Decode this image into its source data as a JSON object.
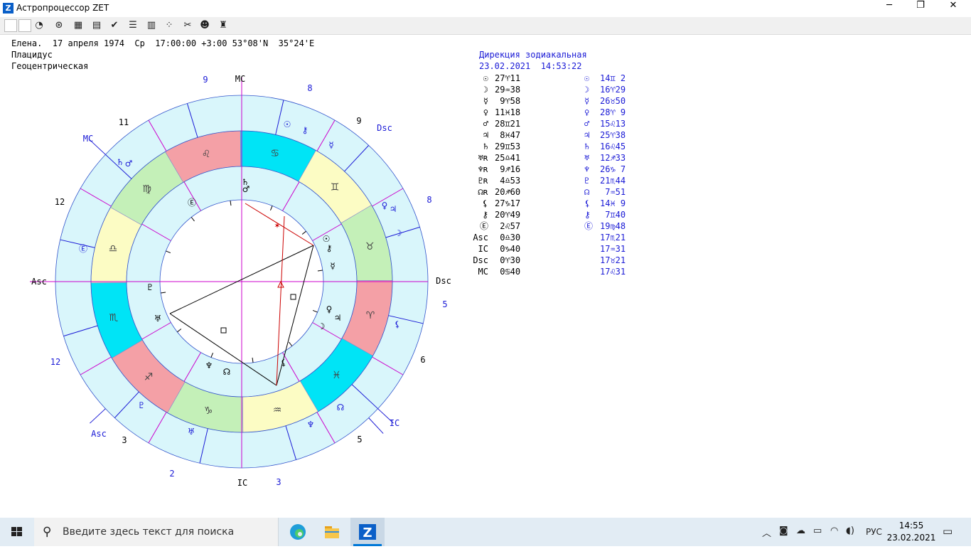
{
  "window": {
    "title": "Астропроцессор ZET",
    "icon": "Z",
    "minimize": "─",
    "restore": "❐",
    "close": "✕"
  },
  "toolbar": [
    {
      "name": "toolbar-blank-1",
      "glyph": ""
    },
    {
      "name": "toolbar-blank-2",
      "glyph": ""
    },
    {
      "name": "toolbar-chart-icon",
      "glyph": "◔"
    },
    {
      "name": "toolbar-wheel-icon",
      "glyph": "⊛"
    },
    {
      "name": "toolbar-grid-icon",
      "glyph": "▦"
    },
    {
      "name": "toolbar-document-icon",
      "glyph": "▤"
    },
    {
      "name": "toolbar-check-icon",
      "glyph": "✔"
    },
    {
      "name": "toolbar-text-icon",
      "glyph": "☰"
    },
    {
      "name": "toolbar-table-icon",
      "glyph": "▥"
    },
    {
      "name": "toolbar-dots-icon",
      "glyph": "⁘"
    },
    {
      "name": "toolbar-tools-icon",
      "glyph": "✂"
    },
    {
      "name": "toolbar-person-icon",
      "glyph": "☻"
    },
    {
      "name": "toolbar-run-icon",
      "glyph": "♜"
    }
  ],
  "header": {
    "line1": "Елена.  17 апреля 1974  Ср  17:00:00 +3:00 53°08'N  35°24'E",
    "line2": "Плацидус",
    "line3": "Геоцентрическая"
  },
  "chart_data": {
    "type": "other",
    "title": "",
    "natal_angles": [
      {
        "label": "MC",
        "color": "#000000"
      },
      {
        "label": "Asc",
        "color": "#000000"
      },
      {
        "label": "Dsc",
        "color": "#000000"
      },
      {
        "label": "IC",
        "color": "#000000"
      }
    ],
    "direction_angles": [
      {
        "label": "MC",
        "color": "#1a1ad6"
      },
      {
        "label": "Dsc",
        "color": "#1a1ad6"
      },
      {
        "label": "Asc",
        "color": "#1a1ad6"
      },
      {
        "label": "IC",
        "color": "#1a1ad6"
      }
    ],
    "natal_house_labels": [
      "9",
      "11",
      "12",
      "Asc",
      "12",
      "3",
      "2",
      "IC",
      "3",
      "5",
      "6",
      "Dsc",
      "5",
      "8",
      "9",
      "8"
    ],
    "zodiac_sectors": [
      {
        "sign": "♈",
        "color": "#f4a0a6"
      },
      {
        "sign": "♉",
        "color": "#c4f0b8"
      },
      {
        "sign": "♊",
        "color": "#fcfcc4"
      },
      {
        "sign": "♋",
        "color": "#00e4f6"
      },
      {
        "sign": "♌",
        "color": "#f4a0a6"
      },
      {
        "sign": "♍",
        "color": "#c4f0b8"
      },
      {
        "sign": "♎",
        "color": "#fcfcc4"
      },
      {
        "sign": "♏",
        "color": "#00e4f6"
      },
      {
        "sign": "♐",
        "color": "#f4a0a6"
      },
      {
        "sign": "♑",
        "color": "#c4f0b8"
      },
      {
        "sign": "♒",
        "color": "#fcfcc4"
      },
      {
        "sign": "♓",
        "color": "#00e4f6"
      }
    ],
    "ring_colors": {
      "outer": "#d9f6fb",
      "inner": "#d9f6fb",
      "lines": "#3333cc",
      "cusps": "#cc00cc"
    }
  },
  "panel": {
    "title": "Дирекция зодиакальная",
    "datetime": "23.02.2021  14:53:22",
    "rows": [
      {
        "glyph": "☉",
        "natal": "27♈11",
        "dglyph": "☉",
        "direct": "14♊ 2"
      },
      {
        "glyph": "☽",
        "natal": "29♒38",
        "dglyph": "☽",
        "direct": "16♈29"
      },
      {
        "glyph": "☿",
        "natal": " 9♈58",
        "dglyph": "☿",
        "direct": "26♉50"
      },
      {
        "glyph": "♀",
        "natal": "11♓18",
        "dglyph": "♀",
        "direct": "28♈ 9"
      },
      {
        "glyph": "♂",
        "natal": "28♊21",
        "dglyph": "♂",
        "direct": "15♌13"
      },
      {
        "glyph": "♃",
        "natal": " 8♓47",
        "dglyph": "♃",
        "direct": "25♈38"
      },
      {
        "glyph": "♄",
        "natal": "29♊53",
        "dglyph": "♄",
        "direct": "16♌45"
      },
      {
        "glyph": "♅ʀ",
        "natal": "25♎41",
        "dglyph": "♅",
        "direct": "12♐33"
      },
      {
        "glyph": "♆ʀ",
        "natal": " 9♐16",
        "dglyph": "♆",
        "direct": "26♑ 7"
      },
      {
        "glyph": "♇ʀ",
        "natal": " 4♎53",
        "dglyph": "♇",
        "direct": "21♏44"
      },
      {
        "glyph": "☊ʀ",
        "natal": "20♐60",
        "dglyph": "☊",
        "direct": " 7♒51"
      },
      {
        "glyph": "⚸",
        "natal": "27♑17",
        "dglyph": "⚸",
        "direct": "14♓ 9"
      },
      {
        "glyph": "⚷",
        "natal": "20♈49",
        "dglyph": "⚷",
        "direct": " 7♊40"
      },
      {
        "glyph": "Ⓔ",
        "natal": " 2♌57",
        "dglyph": "Ⓔ",
        "direct": "19♍48"
      },
      {
        "glyph": "Asc",
        "natal": " 0♎30",
        "dglyph": "",
        "direct": "17♏21"
      },
      {
        "glyph": "IC",
        "natal": " 0♑40",
        "dglyph": "",
        "direct": "17♒31"
      },
      {
        "glyph": "Dsc",
        "natal": " 0♈30",
        "dglyph": "",
        "direct": "17♉21"
      },
      {
        "glyph": "MC",
        "natal": " 0♋40",
        "dglyph": "",
        "direct": "17♌31"
      }
    ]
  },
  "taskbar": {
    "start_icon": "windows-logo",
    "search_placeholder": "Введите здесь текст для поиска",
    "language": "РУС",
    "time": "14:55",
    "date": "23.02.2021"
  }
}
